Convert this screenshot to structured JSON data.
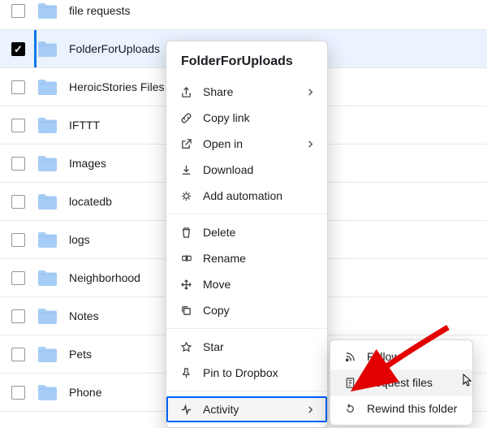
{
  "folders": [
    {
      "name": "file requests",
      "selected": false
    },
    {
      "name": "FolderForUploads",
      "selected": true
    },
    {
      "name": "HeroicStories Files",
      "selected": false
    },
    {
      "name": "IFTTT",
      "selected": false
    },
    {
      "name": "Images",
      "selected": false
    },
    {
      "name": "locatedb",
      "selected": false
    },
    {
      "name": "logs",
      "selected": false
    },
    {
      "name": "Neighborhood",
      "selected": false
    },
    {
      "name": "Notes",
      "selected": false
    },
    {
      "name": "Pets",
      "selected": false
    },
    {
      "name": "Phone",
      "selected": false
    }
  ],
  "context_menu": {
    "title": "FolderForUploads",
    "groups": [
      [
        {
          "icon": "share",
          "label": "Share",
          "submenu": true
        },
        {
          "icon": "link",
          "label": "Copy link"
        },
        {
          "icon": "open",
          "label": "Open in",
          "submenu": true
        },
        {
          "icon": "download",
          "label": "Download"
        },
        {
          "icon": "automation",
          "label": "Add automation"
        }
      ],
      [
        {
          "icon": "delete",
          "label": "Delete"
        },
        {
          "icon": "rename",
          "label": "Rename"
        },
        {
          "icon": "move",
          "label": "Move"
        },
        {
          "icon": "copy",
          "label": "Copy"
        }
      ],
      [
        {
          "icon": "star",
          "label": "Star"
        },
        {
          "icon": "pin",
          "label": "Pin to Dropbox"
        }
      ],
      [
        {
          "icon": "activity",
          "label": "Activity",
          "submenu": true,
          "active": true
        }
      ]
    ]
  },
  "submenu": {
    "items": [
      {
        "icon": "follow",
        "label": "Follow"
      },
      {
        "icon": "request",
        "label": "Request files",
        "hover": true
      },
      {
        "icon": "rewind",
        "label": "Rewind this folder"
      }
    ]
  }
}
